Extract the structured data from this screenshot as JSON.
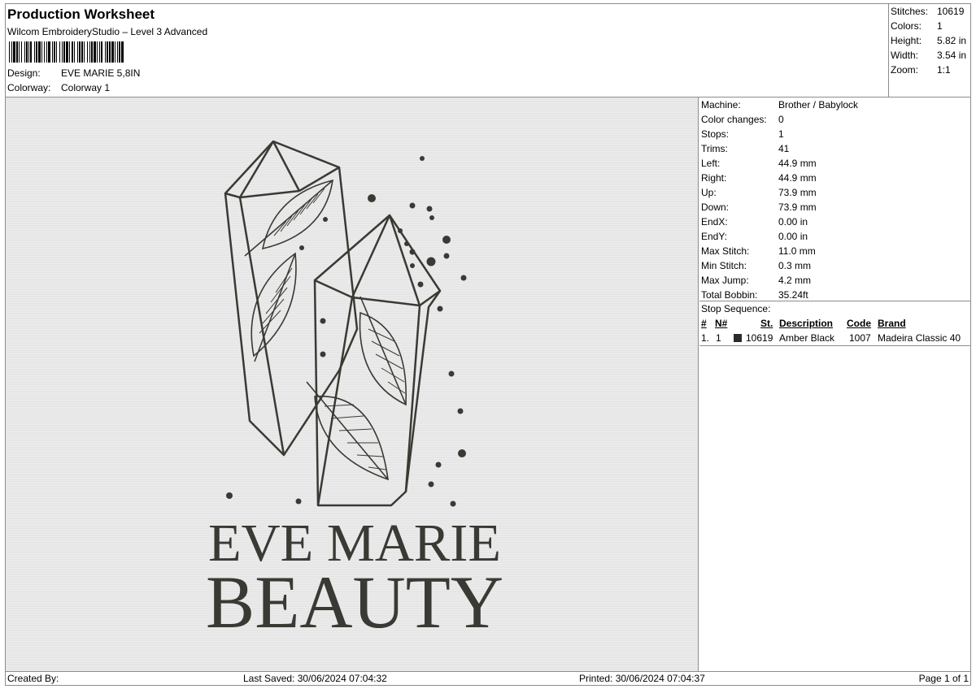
{
  "header": {
    "title": "Production Worksheet",
    "software": "Wilcom EmbroideryStudio – Level 3 Advanced",
    "design_label": "Design:",
    "design_value": "EVE MARIE 5,8IN",
    "colorway_label": "Colorway:",
    "colorway_value": "Colorway 1"
  },
  "stats": [
    {
      "label": "Stitches:",
      "value": "10619"
    },
    {
      "label": "Colors:",
      "value": "1"
    },
    {
      "label": "Height:",
      "value": "5.82 in"
    },
    {
      "label": "Width:",
      "value": "3.54 in"
    },
    {
      "label": "Zoom:",
      "value": "1:1"
    }
  ],
  "details": [
    {
      "label": "Machine:",
      "value": "Brother / Babylock"
    },
    {
      "label": "Color changes:",
      "value": "0"
    },
    {
      "label": "Stops:",
      "value": "1"
    },
    {
      "label": "Trims:",
      "value": "41"
    },
    {
      "label": "Left:",
      "value": "44.9 mm"
    },
    {
      "label": "Right:",
      "value": "44.9 mm"
    },
    {
      "label": "Up:",
      "value": "73.9 mm"
    },
    {
      "label": "Down:",
      "value": "73.9 mm"
    },
    {
      "label": "EndX:",
      "value": "0.00 in"
    },
    {
      "label": "EndY:",
      "value": "0.00 in"
    },
    {
      "label": "Max Stitch:",
      "value": "11.0 mm"
    },
    {
      "label": "Min Stitch:",
      "value": "0.3 mm"
    },
    {
      "label": "Max Jump:",
      "value": "4.2 mm"
    },
    {
      "label": "Total Bobbin:",
      "value": "35.24ft"
    }
  ],
  "stop_sequence": {
    "title": "Stop Sequence:",
    "headers": [
      "#",
      "N#",
      "St.",
      "Description",
      "Code",
      "Brand"
    ],
    "rows": [
      {
        "index": "1.",
        "needle": "1",
        "color": "#2b2b27",
        "stitches": "10619",
        "description": "Amber Black",
        "code": "1007",
        "brand": "Madeira Classic 40"
      }
    ]
  },
  "design_text": {
    "line1": "EVE MARIE",
    "line2": "BEAUTY",
    "thread_color": "#3a3a34"
  },
  "footer": {
    "created_by": "Created By:",
    "last_saved": "Last Saved: 30/06/2024 07:04:32",
    "printed": "Printed: 30/06/2024 07:04:37",
    "page": "Page 1 of 1"
  }
}
